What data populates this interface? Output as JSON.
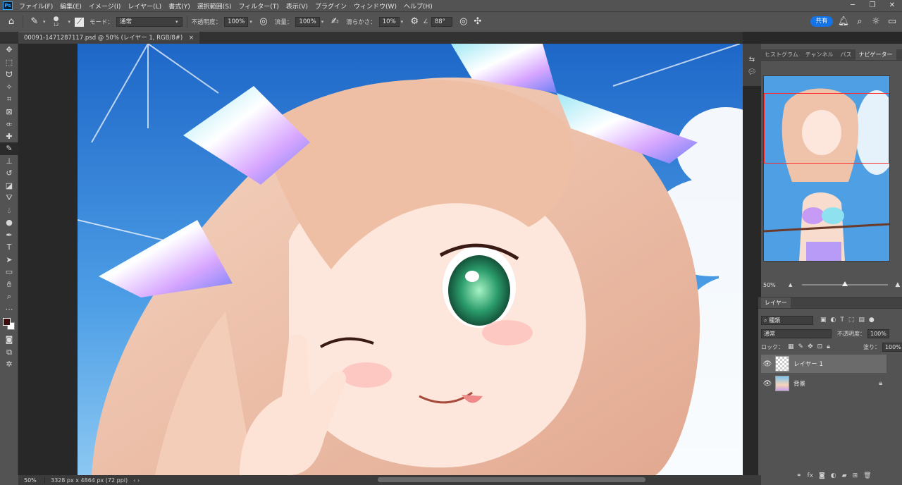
{
  "app": {
    "logo": "Ps"
  },
  "menu": [
    "ファイル(F)",
    "編集(E)",
    "イメージ(I)",
    "レイヤー(L)",
    "書式(Y)",
    "選択範囲(S)",
    "フィルター(T)",
    "表示(V)",
    "プラグイン",
    "ウィンドウ(W)",
    "ヘルプ(H)"
  ],
  "window_controls": {
    "minimize": "─",
    "restore": "❐",
    "close": "✕"
  },
  "options": {
    "brush_size": "12",
    "mode_label": "モード：",
    "mode_value": "通常",
    "opacity_label": "不透明度：",
    "opacity_value": "100%",
    "flow_label": "流量：",
    "flow_value": "100%",
    "smoothing_label": "滑らかさ：",
    "smoothing_value": "10%",
    "angle_value": "88°",
    "share_label": "共有"
  },
  "document_tab": {
    "title": "00091-1471287117.psd @ 50% (レイヤー 1, RGB/8#)",
    "close": "×"
  },
  "panels": {
    "top_tabs": [
      "ヒストグラム",
      "チャンネル",
      "パス",
      "ナビゲーター"
    ],
    "active_top_tab": 3,
    "navigator_zoom": "50%",
    "navigator_zoom_level": 0.5,
    "layers_tab": "レイヤー",
    "filter_kind": "種類",
    "blend_mode": "通常",
    "opacity_label": "不透明度：",
    "opacity_value": "100%",
    "lock_label": "ロック：",
    "fill_label": "塗り：",
    "fill_value": "100%",
    "layers": [
      {
        "name": "レイヤー 1",
        "selected": true,
        "locked": false
      },
      {
        "name": "背景",
        "selected": false,
        "locked": true
      }
    ]
  },
  "colors": {
    "foreground": "#3d0d0d",
    "background": "#ffffff",
    "accent": "#1473e6"
  },
  "status": {
    "zoom": "50%",
    "doc_size": "3328 px x 4864 px (72 ppi)",
    "arrows": "‹ ›"
  }
}
